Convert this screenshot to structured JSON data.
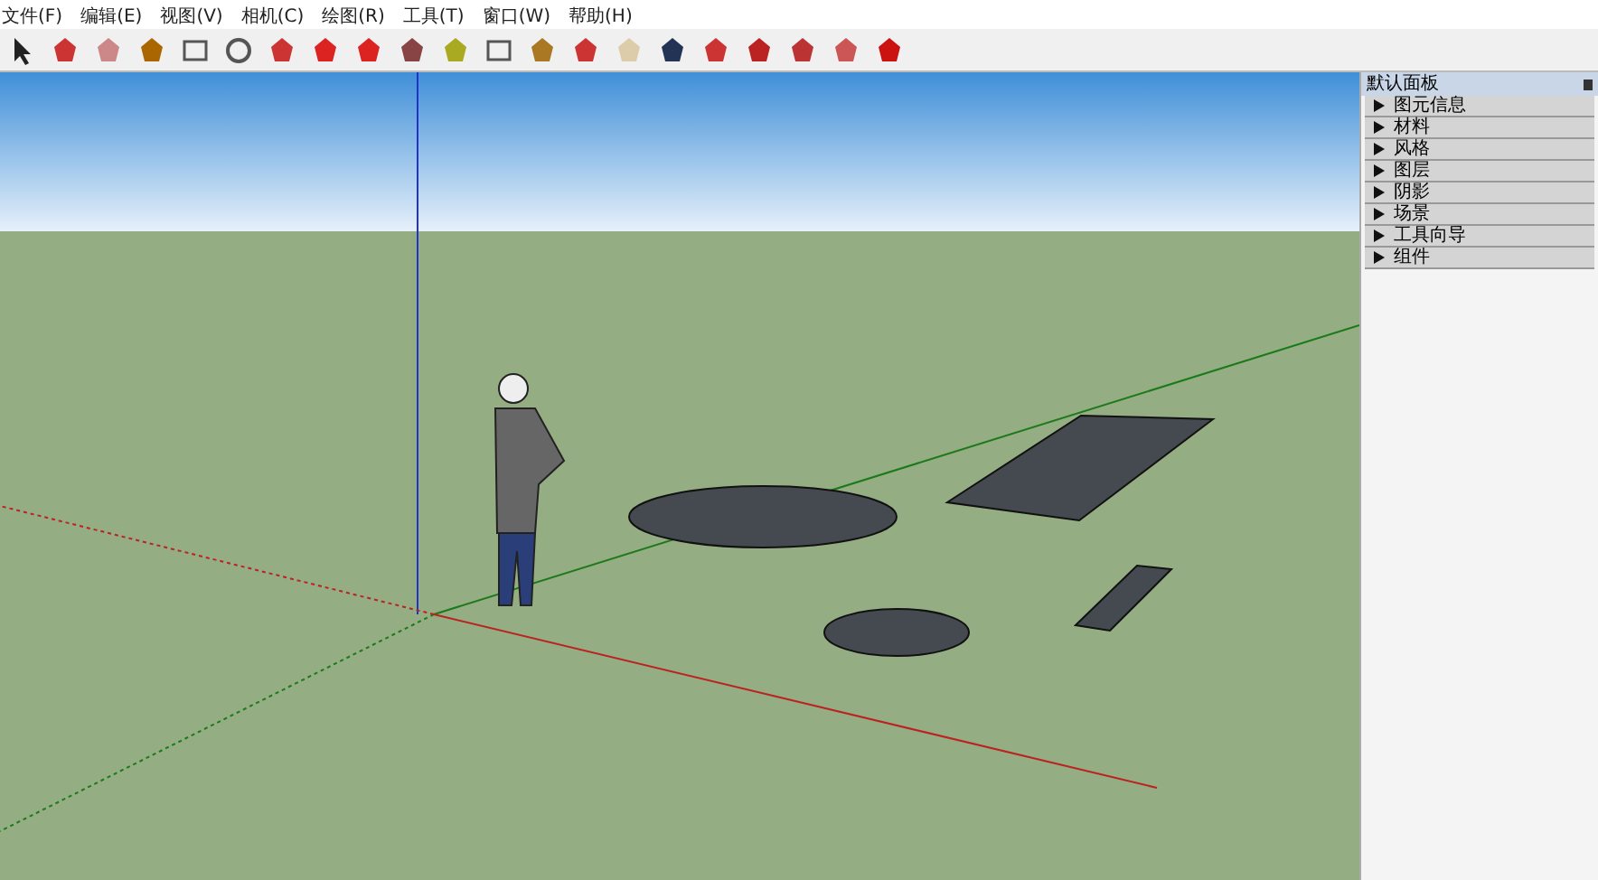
{
  "menu": [
    "文件(F)",
    "编辑(E)",
    "视图(V)",
    "相机(C)",
    "绘图(R)",
    "工具(T)",
    "窗口(W)",
    "帮助(H)"
  ],
  "panel": {
    "title": "默认面板",
    "items": [
      {
        "label": "图元信息",
        "expanded": false
      },
      {
        "label": "材料",
        "expanded": false
      },
      {
        "label": "风格",
        "expanded": false
      },
      {
        "label": "图层",
        "expanded": false
      },
      {
        "label": "阴影",
        "expanded": false
      },
      {
        "label": "场景",
        "expanded": false
      },
      {
        "label": "工具向导",
        "expanded": false
      },
      {
        "label": "组件",
        "expanded": false
      }
    ]
  }
}
